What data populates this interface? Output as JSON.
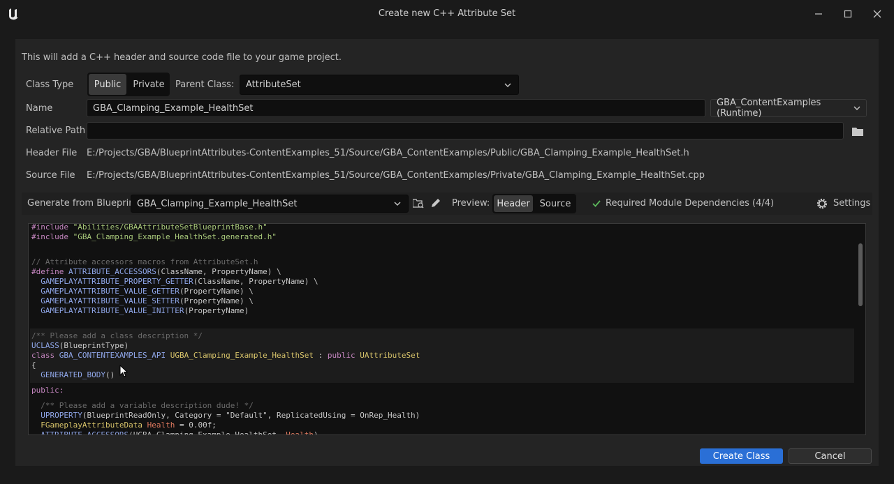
{
  "window": {
    "title": "Create new C++ Attribute Set"
  },
  "intro_text": "This will add a C++ header and source code file to your game project.",
  "class_type": {
    "label": "Class Type",
    "options": [
      "Public",
      "Private"
    ],
    "selected": "Public"
  },
  "parent_class": {
    "label": "Parent Class:",
    "value": "AttributeSet"
  },
  "name": {
    "label": "Name",
    "value": "GBA_Clamping_Example_HealthSet",
    "module": "GBA_ContentExamples (Runtime)"
  },
  "relative_path": {
    "label": "Relative Path",
    "value": ""
  },
  "header_file": {
    "label": "Header File",
    "value": "E:/Projects/GBA/BlueprintAttributes-ContentExamples_51/Source/GBA_ContentExamples/Public/GBA_Clamping_Example_HealthSet.h"
  },
  "source_file": {
    "label": "Source File",
    "value": "E:/Projects/GBA/BlueprintAttributes-ContentExamples_51/Source/GBA_ContentExamples/Private/GBA_Clamping_Example_HealthSet.cpp"
  },
  "generate": {
    "label": "Generate from Blueprint:",
    "value": "GBA_Clamping_Example_HealthSet"
  },
  "preview": {
    "label": "Preview:",
    "options": [
      "Header",
      "Source"
    ],
    "selected": "Header"
  },
  "dependencies": "Required Module Dependencies (4/4)",
  "settings_label": "Settings",
  "code_lines": [
    {
      "t": "#include \"Abilities/GBAAttributeSetBlueprintBase.h\""
    },
    {
      "t": "#include \"GBA_Clamping_Example_HealthSet.generated.h\""
    },
    {
      "t": "// Attribute accessors macros from AttributeSet.h"
    },
    {
      "t": "#define ATTRIBUTE_ACCESSORS(ClassName, PropertyName) \\"
    },
    {
      "t": "  GAMEPLAYATTRIBUTE_PROPERTY_GETTER(ClassName, PropertyName) \\"
    },
    {
      "t": "  GAMEPLAYATTRIBUTE_VALUE_GETTER(PropertyName) \\"
    },
    {
      "t": "  GAMEPLAYATTRIBUTE_VALUE_SETTER(PropertyName) \\"
    },
    {
      "t": "  GAMEPLAYATTRIBUTE_VALUE_INITTER(PropertyName)"
    },
    {
      "t": "/** Please add a class description */"
    },
    {
      "t": "UCLASS(BlueprintType)"
    },
    {
      "t": "class GBA_CONTENTEXAMPLES_API UGBA_Clamping_Example_HealthSet : public UAttributeSet"
    },
    {
      "t": "{"
    },
    {
      "t": "  GENERATED_BODY()"
    },
    {
      "t": "public:"
    },
    {
      "t": "  /** Please add a variable description dude! */"
    },
    {
      "t": "  UPROPERTY(BlueprintReadOnly, Category = \"Default\", ReplicatedUsing = OnRep_Health)"
    },
    {
      "t": "  FGameplayAttributeData Health = 0.00f;"
    },
    {
      "t": "  ATTRIBUTE_ACCESSORS(UGBA_Clamping_Example_HealthSet, Health)"
    }
  ],
  "buttons": {
    "create": "Create Class",
    "cancel": "Cancel"
  },
  "colors": {
    "accent": "#2a6fd6",
    "check": "#5bb85b"
  }
}
